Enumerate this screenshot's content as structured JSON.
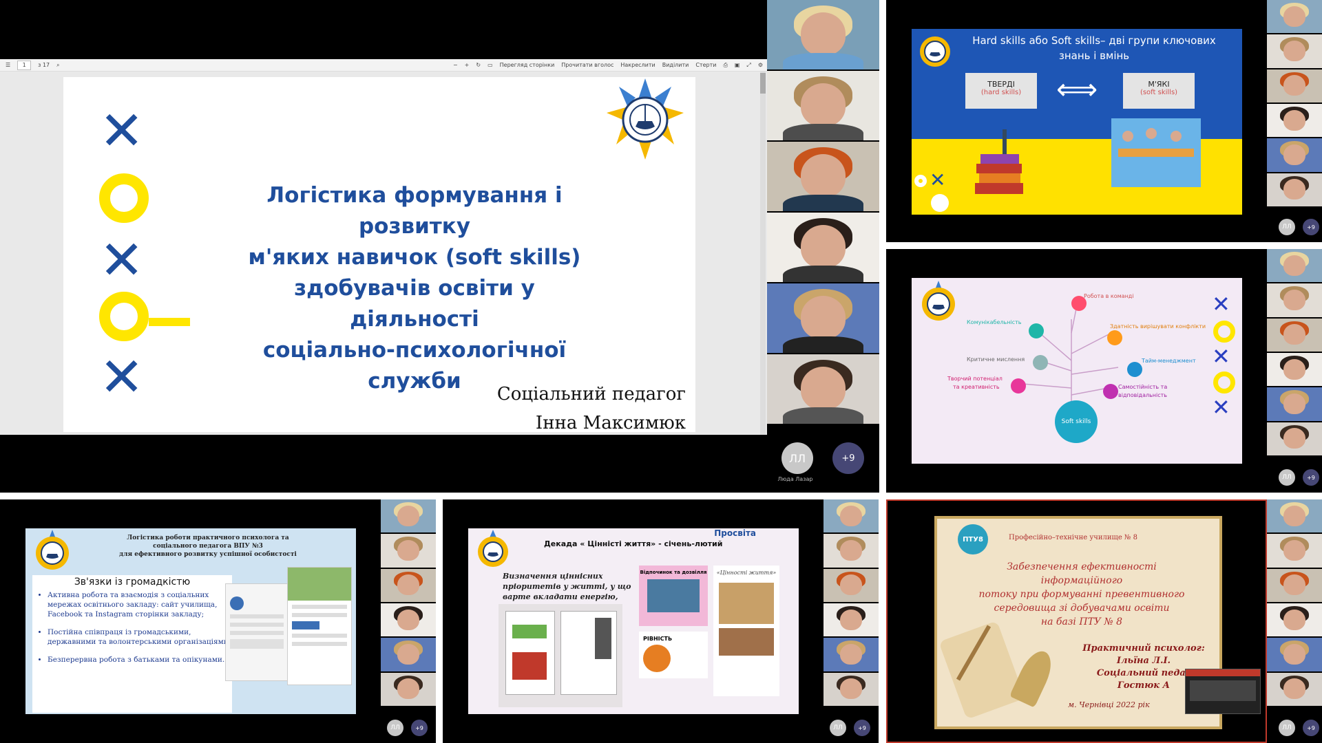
{
  "tile1": {
    "toolbar": {
      "page_value": "1",
      "page_total": "з 17",
      "view_label": "Перегляд сторінки",
      "read_aloud_label": "Прочитати вголос",
      "draw_label": "Накреслити",
      "highlight_label": "Виділити",
      "erase_label": "Стерти"
    },
    "slide": {
      "title_line1": "Логістика формування і розвитку",
      "title_line2": "м'яких навичок (soft skills)",
      "title_line3": "здобувачів освіти у діяльності",
      "title_line4": "соціально-психологічної служби",
      "author_line1": "Соціальний педагог",
      "author_line2": "Інна Максимюк"
    },
    "participant_initials": "ЛЛ",
    "participant_name": "Люда Лазар",
    "more_count": "+9"
  },
  "tile2": {
    "slide": {
      "title_line1": "Hard skills або Soft skills– дві групи ключових",
      "title_line2": "знань і вмінь",
      "box_left_title": "ТВЕРДІ",
      "box_left_sub": "(hard skills)",
      "box_right_title": "М'ЯКІ",
      "box_right_sub": "(soft skills)"
    },
    "participant_initials": "ЛЛ",
    "more_count": "+9"
  },
  "tile3": {
    "slide": {
      "center_label": "Soft skills",
      "items": [
        "Робота в команді",
        "Комунікабельність",
        "Здатність вирішувати конфлікти",
        "Критичне мислення",
        "Тайм-менеджмент",
        "Творчий потенціал",
        "та креативність",
        "Самостійність та",
        "відповідальність"
      ]
    },
    "participant_initials": "ЛЛ",
    "more_count": "+9"
  },
  "tile4": {
    "slide": {
      "header_line1": "Логістика роботи практичного психолога та",
      "header_line2": "соціального педагога ВПУ №3",
      "header_line3": "для ефективного розвитку успішної особистості",
      "section_title": "Зв'язки із громадкістю",
      "bullet1": "Активна робота та взаємодія з соціальних мережах освітнього закладу: сайт училища, Facebook та Instagram сторінки закладу;",
      "bullet2": "Постійна співпраця із громадськими, державними та волонтерськими організаціями;",
      "bullet3": "Безперервна робота з батьками та опікунами."
    },
    "participant_initials": "ЛЛ",
    "more_count": "+9"
  },
  "tile5": {
    "slide": {
      "top_label": "Просвіта",
      "title": "Декада « Цінністі життя» - січень-лютий",
      "script_text": "Визначення ціннісних пріоритетів у житті, у що варте вкладати енергію, ресурси і час",
      "card_label1": "Відпочинок та дозвілля",
      "card_label2": "РІВНІСТЬ",
      "card_label3": "«Цінності життя»"
    },
    "participant_initials": "ЛЛ",
    "more_count": "+9"
  },
  "tile6": {
    "slide": {
      "school": "Професійно–технічне училище № 8",
      "logo_text": "ПТУ8",
      "title_line1": "Забезпечення ефективності інформаційного",
      "title_line2": "потоку при формуванні превентивного",
      "title_line3": "середовища зі добувачами освіти",
      "title_line4": "на базі ПТУ № 8",
      "role1": "Практичний психолог:",
      "name1": "Ільїна Л.І.",
      "role2": "Соціальний педаг",
      "name2": "Гостюк А",
      "city": "м. Чернівці 2022 рік"
    },
    "participant_initials": "ЛЛ",
    "more_count": "+9"
  },
  "colors": {
    "accent_blue": "#1f4e9c",
    "accent_yellow": "#ffe600",
    "teams_more": "#464775"
  }
}
